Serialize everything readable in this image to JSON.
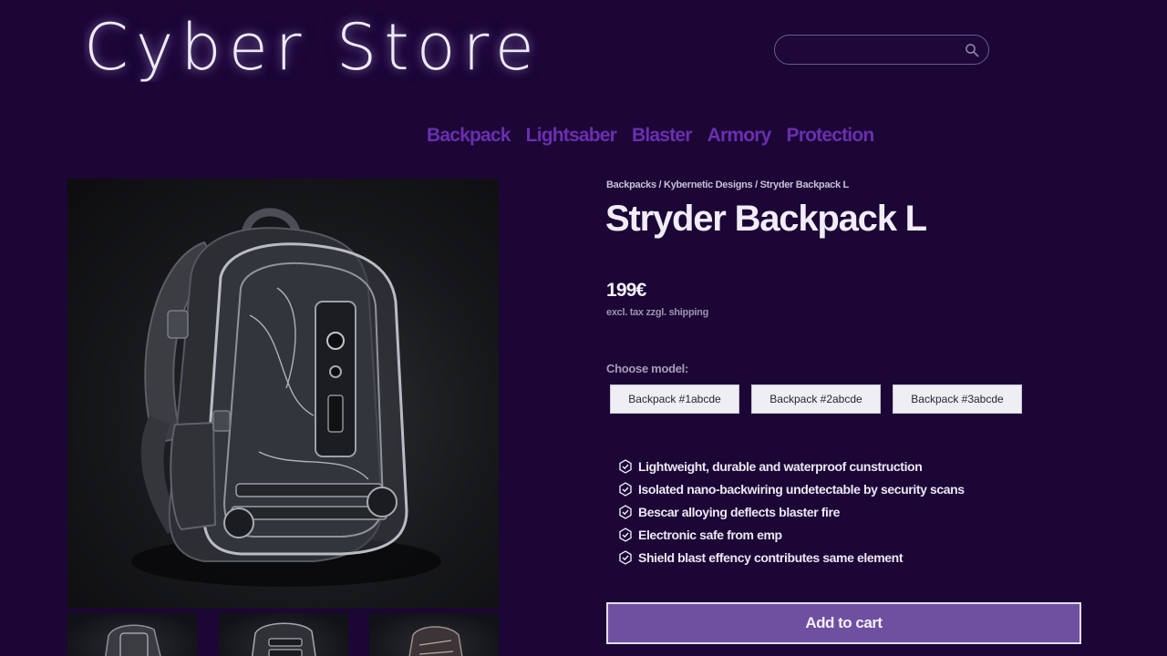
{
  "logo": {
    "text": "Cyber Store"
  },
  "search": {
    "placeholder": "",
    "icon": "search-icon"
  },
  "nav": [
    {
      "label": "Backpack"
    },
    {
      "label": "Lightsaber"
    },
    {
      "label": "Blaster"
    },
    {
      "label": "Armory"
    },
    {
      "label": "Protection"
    }
  ],
  "product": {
    "breadcrumb": "Backpacks / Kybernetic Designs / Stryder Backpack L",
    "title": "Stryder Backpack L",
    "price": "199€",
    "tax_note": "excl. tax zzgl. shipping",
    "choose_label": "Choose model:",
    "models": [
      {
        "label": "Backpack #1abcde"
      },
      {
        "label": "Backpack #2abcde"
      },
      {
        "label": "Backpack #3abcde"
      }
    ],
    "features": [
      {
        "icon": "hexagon-check-icon",
        "text": "Lightweight, durable and waterproof cunstruction"
      },
      {
        "icon": "hexagon-check-icon",
        "text": "Isolated nano-backwiring undetectable by security scans"
      },
      {
        "icon": "hexagon-check-icon",
        "text": "Bescar alloying deflects blaster fire"
      },
      {
        "icon": "hexagon-check-icon",
        "text": "Electronic safe from emp"
      },
      {
        "icon": "hexagon-check-icon",
        "text": "Shield blast effency contributes same element"
      }
    ],
    "add_to_cart": "Add to cart"
  },
  "colors": {
    "background": "#1b0636",
    "nav_link": "#6a2fb0",
    "cart_button": "#6f50a0"
  }
}
